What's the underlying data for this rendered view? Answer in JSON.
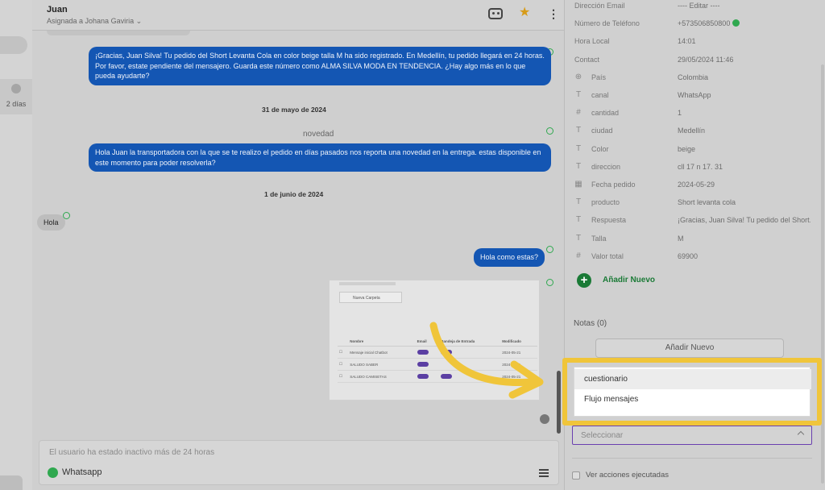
{
  "sidebar_left": {
    "time_label": "2 días"
  },
  "chat": {
    "contact_name": "Juan",
    "assigned_to": "Asignada a Johana Gaviria",
    "messages": [
      {
        "type": "out",
        "text": "¡Gracias, Juan Silva! Tu pedido del Short Levanta Cola en color beige talla M ha sido registrado. En Medellín, tu pedido llegará en 24 horas. Por favor, estate pendiente del mensajero. Guarda este número como ALMA SILVA MODA EN TENDENCIA. ¿Hay algo más en lo que pueda ayudarte?"
      },
      {
        "type": "date",
        "text": "31 de mayo de 2024"
      },
      {
        "type": "label",
        "text": "novedad"
      },
      {
        "type": "out",
        "text": "Hola Juan la transportadora con la que se te realizo el pedido en días pasados nos reporta una novedad en la entrega. estas disponible en este momento para poder resolverla?"
      },
      {
        "type": "date",
        "text": "1 de junio de 2024"
      },
      {
        "type": "in",
        "text": "Hola"
      },
      {
        "type": "out",
        "text": "Hola como estas?"
      }
    ],
    "image_message": {
      "new_folder": "Nueva Carpeta",
      "columns": [
        "Nombre",
        "Email",
        "Bandeja de Entrada",
        "Modificado"
      ],
      "rows": [
        [
          "Mensaje inicial Chatbot",
          "",
          "",
          "2024-05-21"
        ],
        [
          "SALUDO SABER",
          "",
          "",
          "2024-05-21"
        ],
        [
          "SALUDO CAMISETAS",
          "",
          "",
          "2024-05-21"
        ]
      ]
    },
    "composer": {
      "inactive_notice": "El usuario ha estado inactivo más de 24 horas",
      "channel": "Whatsapp"
    }
  },
  "contact_panel": {
    "fields": [
      {
        "label": "Dirección Email",
        "value": "---- Editar ----",
        "icon": ""
      },
      {
        "label": "Número de Teléfono",
        "value": "+573506850800",
        "icon": "",
        "verified": true
      },
      {
        "label": "Hora Local",
        "value": "14:01",
        "icon": ""
      },
      {
        "label": "Contact",
        "value": "29/05/2024 11:46",
        "icon": ""
      },
      {
        "label": "País",
        "value": "Colombia",
        "icon": "globe-icon"
      },
      {
        "label": "canal",
        "value": "WhatsApp",
        "icon": "text-icon"
      },
      {
        "label": "cantidad",
        "value": "1",
        "icon": "hash-icon"
      },
      {
        "label": "ciudad",
        "value": "Medellín",
        "icon": "text-icon"
      },
      {
        "label": "Color",
        "value": "beige",
        "icon": "text-icon"
      },
      {
        "label": "direccion",
        "value": "cll 17 n 17. 31",
        "icon": "text-icon"
      },
      {
        "label": "Fecha pedido",
        "value": "2024-05-29",
        "icon": "calendar-icon"
      },
      {
        "label": "producto",
        "value": "Short levanta cola",
        "icon": "text-icon"
      },
      {
        "label": "Respuesta",
        "value": "¡Gracias, Juan Silva! Tu pedido del Short...",
        "icon": "text-icon"
      },
      {
        "label": "Talla",
        "value": "M",
        "icon": "text-icon"
      },
      {
        "label": "Valor total",
        "value": "69900",
        "icon": "hash-icon"
      }
    ],
    "add_new_label": "Añadir Nuevo",
    "notes_title": "Notas (0)",
    "notes_add_button": "Añadir Nuevo",
    "dropdown_options": [
      "cuestionario",
      "Flujo mensajes"
    ],
    "select_placeholder": "Seleccionar",
    "executed_actions_label": "Ver acciones ejecutadas"
  },
  "colors": {
    "highlight": "#f0c53a",
    "outgoing_bubble": "#1456b3",
    "accent_green": "#1a7a36",
    "select_border": "#6a3fb0"
  }
}
